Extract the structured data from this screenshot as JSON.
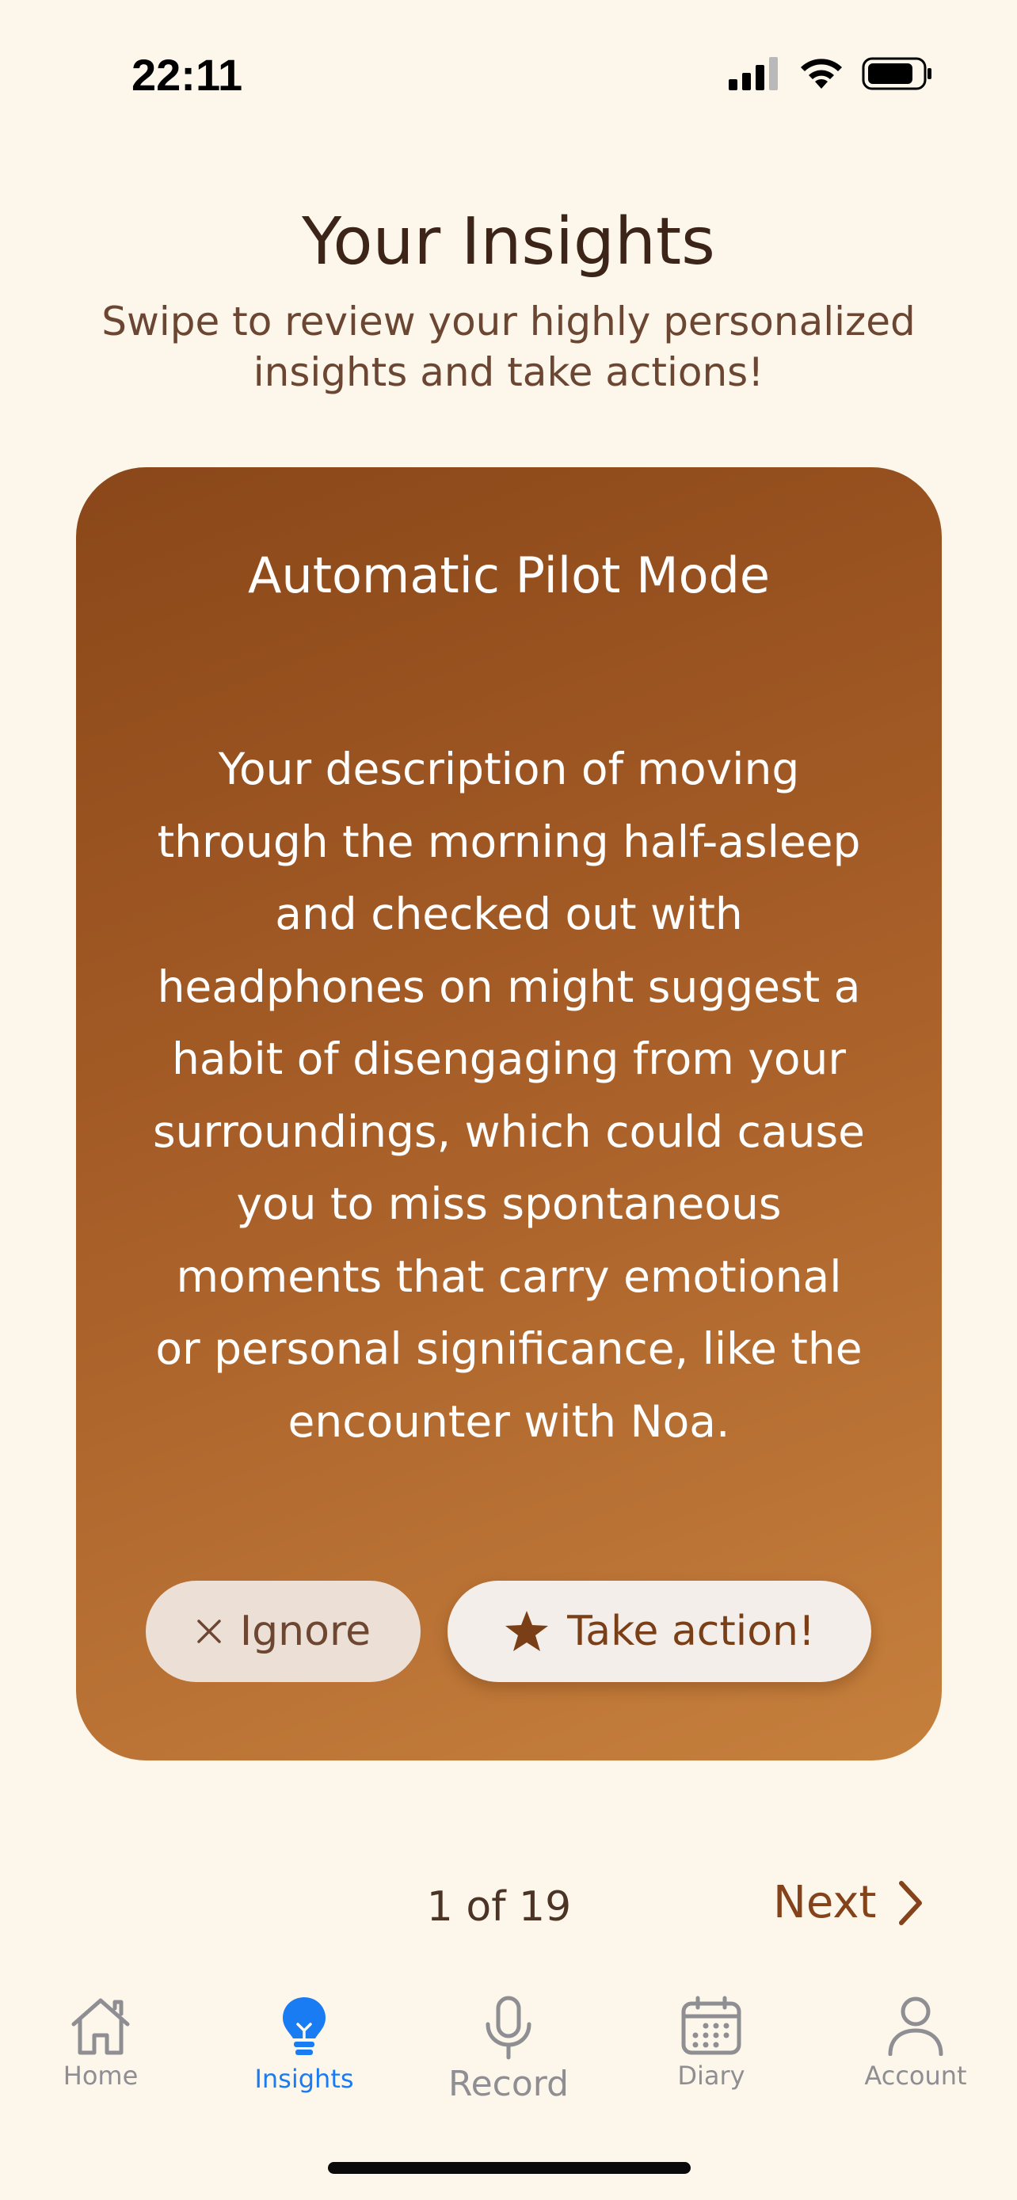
{
  "status_bar": {
    "time": "22:11"
  },
  "header": {
    "title": "Your Insights",
    "subtitle_line1": "Swipe to review your highly personalized",
    "subtitle_line2": "insights and take actions!"
  },
  "card": {
    "title": "Automatic Pilot Mode",
    "body_lines": [
      "Your description of moving",
      "through the morning half-asleep",
      "and checked out with",
      "headphones on might suggest a",
      "habit of disengaging from your",
      "surroundings, which could cause",
      "you to miss spontaneous",
      "moments that carry emotional",
      "or personal significance, like the",
      "encounter with Noa."
    ],
    "ignore_label": "Ignore",
    "action_label": "Take action!"
  },
  "pager": {
    "count": "1 of 19",
    "next_label": "Next"
  },
  "tabs": [
    {
      "label": "Home",
      "icon": "house-icon",
      "active": false
    },
    {
      "label": "Insights",
      "icon": "lightbulb-icon",
      "active": true
    },
    {
      "label": "Record",
      "icon": "microphone-icon",
      "active": false
    },
    {
      "label": "Diary",
      "icon": "calendar-icon",
      "active": false
    },
    {
      "label": "Account",
      "icon": "person-icon",
      "active": false
    }
  ],
  "colors": {
    "background": "#fdf6ea",
    "card_gradient_start": "#8a4719",
    "card_gradient_end": "#c6803d",
    "accent_brown": "#84431a",
    "active_tab": "#1a7cf2",
    "inactive_tab": "#8e8e93"
  }
}
